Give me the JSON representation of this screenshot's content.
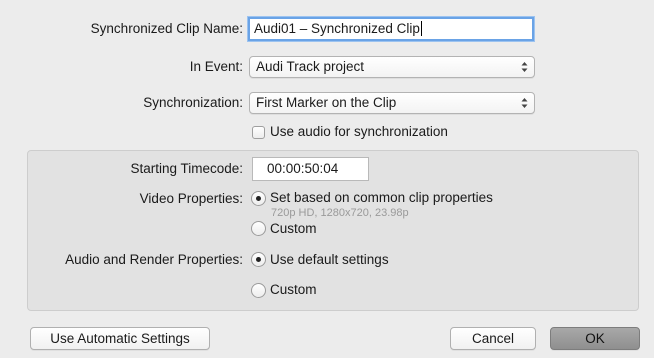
{
  "form": {
    "clip_name_label": "Synchronized Clip Name:",
    "clip_name_value": "Audi01 – Synchronized Clip",
    "event_label": "In Event:",
    "event_value": "Audi Track project",
    "sync_label": "Synchronization:",
    "sync_value": "First Marker on the Clip",
    "use_audio_label": "Use audio for synchronization"
  },
  "group": {
    "timecode_label": "Starting Timecode:",
    "timecode_value": "00:00:50:04",
    "video_label": "Video Properties:",
    "video_option1": "Set based on common clip properties",
    "video_option1_detail": "720p HD, 1280x720, 23.98p",
    "video_option2": "Custom",
    "audio_label": "Audio and Render Properties:",
    "audio_option1": "Use default settings",
    "audio_option2": "Custom"
  },
  "buttons": {
    "automatic": "Use Automatic Settings",
    "cancel": "Cancel",
    "ok": "OK"
  },
  "colors": {
    "dialog_bg": "#ececec",
    "focus_ring": "#6aa3e6",
    "default_button": "#9a9a9a"
  },
  "state": {
    "use_audio_checked": false,
    "video_selected": "Set based on common clip properties",
    "audio_selected": "Use default settings"
  }
}
